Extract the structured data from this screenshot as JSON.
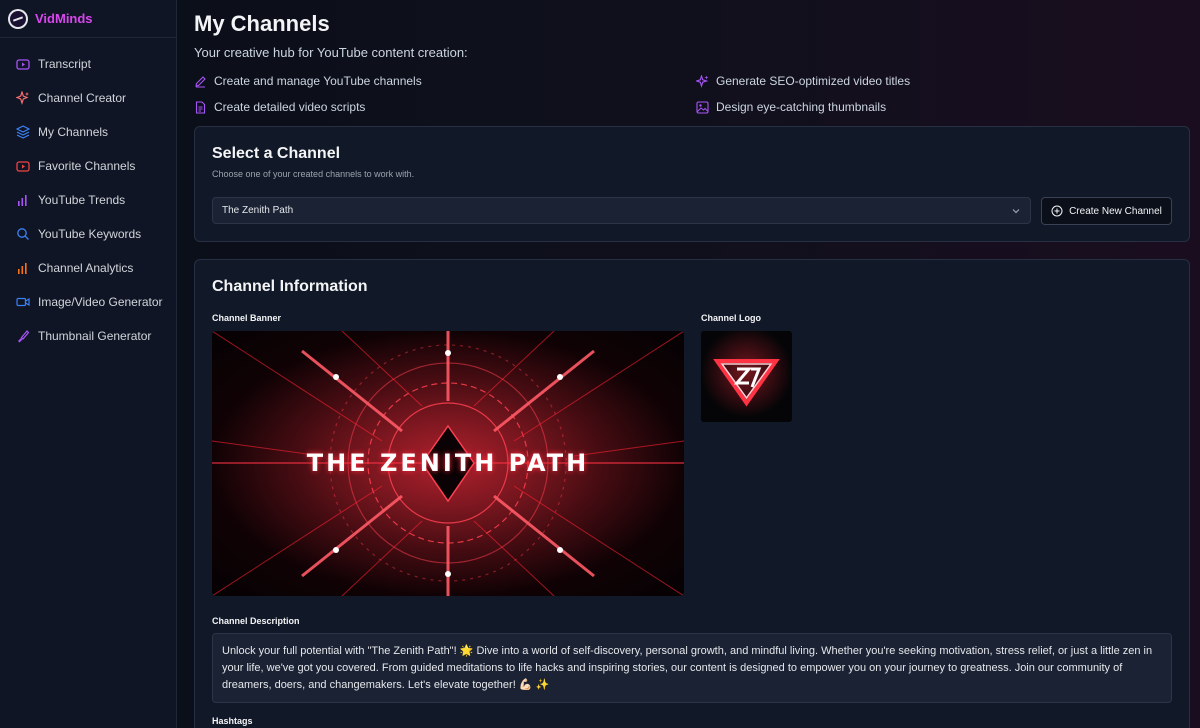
{
  "brand": {
    "name": "VidMinds"
  },
  "sidebar": {
    "items": [
      {
        "label": "Transcript",
        "icon": "youtube-icon"
      },
      {
        "label": "Channel Creator",
        "icon": "sparkles-icon"
      },
      {
        "label": "My Channels",
        "icon": "layers-icon"
      },
      {
        "label": "Favorite Channels",
        "icon": "youtube-icon"
      },
      {
        "label": "YouTube Trends",
        "icon": "bar-chart-icon"
      },
      {
        "label": "YouTube Keywords",
        "icon": "search-icon"
      },
      {
        "label": "Channel Analytics",
        "icon": "bar-chart-icon"
      },
      {
        "label": "Image/Video Generator",
        "icon": "video-icon"
      },
      {
        "label": "Thumbnail Generator",
        "icon": "brush-icon"
      }
    ]
  },
  "header": {
    "title": "My Channels",
    "subtitle": "Your creative hub for YouTube content creation:",
    "features": [
      {
        "label": "Create and manage YouTube channels",
        "icon": "pencil-icon"
      },
      {
        "label": "Generate SEO-optimized video titles",
        "icon": "sparkles-icon"
      },
      {
        "label": "Create detailed video scripts",
        "icon": "document-icon"
      },
      {
        "label": "Design eye-catching thumbnails",
        "icon": "image-icon"
      }
    ]
  },
  "select_card": {
    "title": "Select a Channel",
    "subtitle": "Choose one of your created channels to work with.",
    "selected_channel": "The Zenith Path",
    "create_button": "Create New Channel"
  },
  "info_card": {
    "title": "Channel Information",
    "banner_label": "Channel Banner",
    "banner_text": "THE ZENITH PATH",
    "logo_label": "Channel Logo",
    "description_label": "Channel Description",
    "description": "Unlock your full potential with \"The Zenith Path\"! 🌟 Dive into a world of self-discovery, personal growth, and mindful living. Whether you're seeking motivation, stress relief, or just a little zen in your life, we've got you covered. From guided meditations to life hacks and inspiring stories, our content is designed to empower you on your journey to greatness. Join our community of dreamers, doers, and changemakers. Let's elevate together! 💪🏻 ✨",
    "hashtags_label": "Hashtags"
  },
  "colors": {
    "accent": "#a855f7",
    "brand": "#d946ef",
    "background": "#0b0f1a",
    "card": "#111827"
  }
}
